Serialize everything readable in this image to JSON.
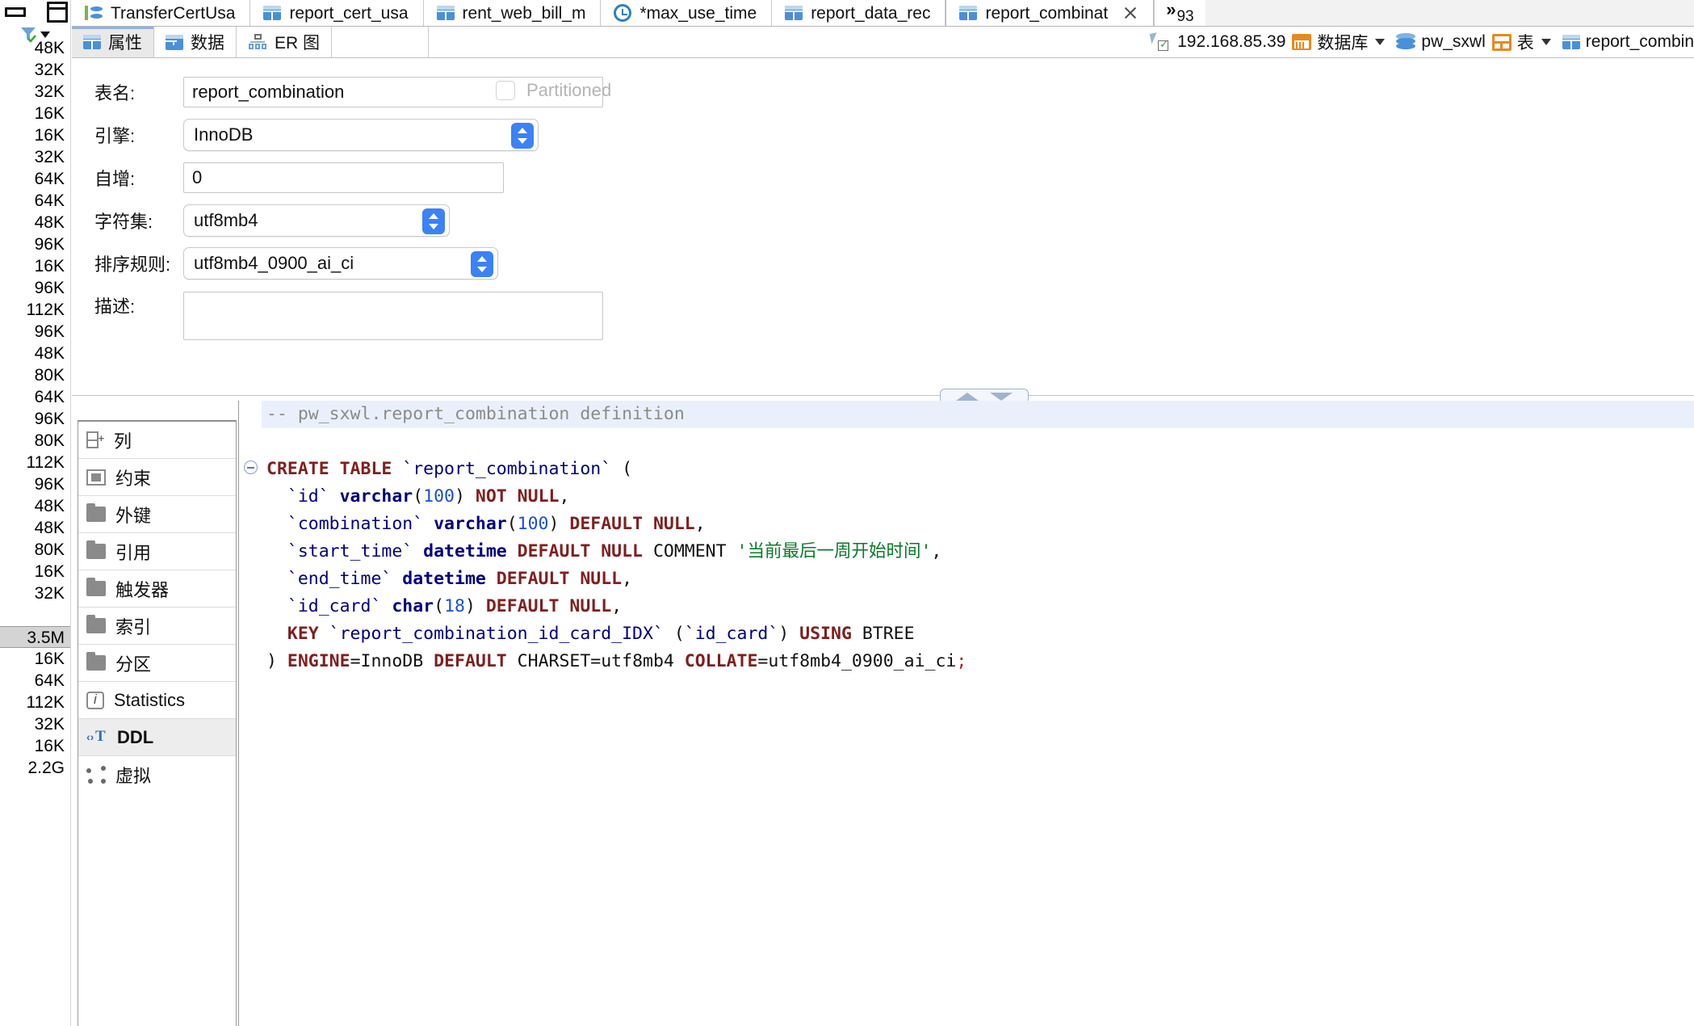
{
  "window": {
    "minimize_icon": "minimize-icon",
    "maximize_icon": "maximize-icon"
  },
  "size_column": {
    "filter_icon": "filter-icon",
    "dropdown_icon": "chevron-down-icon",
    "values": [
      "48K",
      "32K",
      "32K",
      "16K",
      "16K",
      "32K",
      "64K",
      "64K",
      "48K",
      "96K",
      "16K",
      "96K",
      "112K",
      "96K",
      "48K",
      "80K",
      "64K",
      "96K",
      "80K",
      "112K",
      "96K",
      "48K",
      "48K",
      "80K",
      "16K",
      "32K"
    ],
    "selected_value": "3.5M",
    "values_after": [
      "16K",
      "64K",
      "112K",
      "32K",
      "16K",
      "2.2G"
    ]
  },
  "tabs": [
    {
      "label": "TransferCertUsa",
      "icon": "transfer-icon",
      "active": false,
      "closable": false
    },
    {
      "label": "report_cert_usa",
      "icon": "table-icon",
      "active": false,
      "closable": false
    },
    {
      "label": "rent_web_bill_m",
      "icon": "table-icon",
      "active": false,
      "closable": false
    },
    {
      "label": "*max_use_time",
      "icon": "clock-icon",
      "active": false,
      "closable": false
    },
    {
      "label": "report_data_rec",
      "icon": "table-icon",
      "active": false,
      "closable": false
    },
    {
      "label": "report_combinat",
      "icon": "table-icon",
      "active": true,
      "closable": true
    }
  ],
  "tab_overflow": {
    "chevron": "»",
    "count": "93"
  },
  "view_tabs": [
    {
      "label": "属性",
      "icon": "table-icon",
      "active": true
    },
    {
      "label": "数据",
      "icon": "data-icon",
      "active": false
    },
    {
      "label": "ER 图",
      "icon": "er-diagram-icon",
      "active": false
    }
  ],
  "breadcrumb": {
    "connection": "192.168.85.39",
    "database_group": "数据库",
    "schema": "pw_sxwl",
    "table_group": "表",
    "table": "report_combin"
  },
  "properties": {
    "table_name_label": "表名:",
    "table_name_value": "report_combination",
    "engine_label": "引擎:",
    "engine_value": "InnoDB",
    "auto_increment_label": "自增:",
    "auto_increment_value": "0",
    "charset_label": "字符集:",
    "charset_value": "utf8mb4",
    "collation_label": "排序规则:",
    "collation_value": "utf8mb4_0900_ai_ci",
    "description_label": "描述:",
    "description_value": "",
    "partitioned_label": "Partitioned",
    "partitioned_checked": false
  },
  "nav_items": [
    {
      "label": "列",
      "icon": "column-icon",
      "active": false
    },
    {
      "label": "约束",
      "icon": "constraint-icon",
      "active": false
    },
    {
      "label": "外键",
      "icon": "folder-icon",
      "active": false
    },
    {
      "label": "引用",
      "icon": "folder-icon",
      "active": false
    },
    {
      "label": "触发器",
      "icon": "folder-icon",
      "active": false
    },
    {
      "label": "索引",
      "icon": "folder-icon",
      "active": false
    },
    {
      "label": "分区",
      "icon": "folder-icon",
      "active": false
    },
    {
      "label": "Statistics",
      "icon": "info-icon",
      "active": false
    },
    {
      "label": "DDL",
      "icon": "ddl-icon",
      "active": true
    },
    {
      "label": "虚拟",
      "icon": "virtual-icon",
      "active": false
    }
  ],
  "ddl": {
    "comment_line": "-- pw_sxwl.report_combination definition",
    "lines": [
      {
        "tokens": [
          {
            "t": "CREATE TABLE ",
            "c": "k-kw"
          },
          {
            "t": "`report_combination`",
            "c": "k-id"
          },
          {
            "t": " (",
            "c": "k-plain"
          }
        ]
      },
      {
        "tokens": [
          {
            "t": "  `id` ",
            "c": "k-id"
          },
          {
            "t": "varchar",
            "c": "k-type"
          },
          {
            "t": "(",
            "c": "k-plain"
          },
          {
            "t": "100",
            "c": "k-num"
          },
          {
            "t": ") ",
            "c": "k-plain"
          },
          {
            "t": "NOT NULL",
            "c": "k-kw"
          },
          {
            "t": ",",
            "c": "k-plain"
          }
        ]
      },
      {
        "tokens": [
          {
            "t": "  `combination` ",
            "c": "k-id"
          },
          {
            "t": "varchar",
            "c": "k-type"
          },
          {
            "t": "(",
            "c": "k-plain"
          },
          {
            "t": "100",
            "c": "k-num"
          },
          {
            "t": ") ",
            "c": "k-plain"
          },
          {
            "t": "DEFAULT NULL",
            "c": "k-kw"
          },
          {
            "t": ",",
            "c": "k-plain"
          }
        ]
      },
      {
        "tokens": [
          {
            "t": "  `start_time` ",
            "c": "k-id"
          },
          {
            "t": "datetime ",
            "c": "k-type"
          },
          {
            "t": "DEFAULT NULL",
            "c": "k-kw"
          },
          {
            "t": " COMMENT ",
            "c": "k-plain"
          },
          {
            "t": "'当前最后一周开始时间'",
            "c": "k-str"
          },
          {
            "t": ",",
            "c": "k-plain"
          }
        ]
      },
      {
        "tokens": [
          {
            "t": "  `end_time` ",
            "c": "k-id"
          },
          {
            "t": "datetime ",
            "c": "k-type"
          },
          {
            "t": "DEFAULT NULL",
            "c": "k-kw"
          },
          {
            "t": ",",
            "c": "k-plain"
          }
        ]
      },
      {
        "tokens": [
          {
            "t": "  `id_card` ",
            "c": "k-id"
          },
          {
            "t": "char",
            "c": "k-type"
          },
          {
            "t": "(",
            "c": "k-plain"
          },
          {
            "t": "18",
            "c": "k-num"
          },
          {
            "t": ") ",
            "c": "k-plain"
          },
          {
            "t": "DEFAULT NULL",
            "c": "k-kw"
          },
          {
            "t": ",",
            "c": "k-plain"
          }
        ]
      },
      {
        "tokens": [
          {
            "t": "  KEY ",
            "c": "k-kw"
          },
          {
            "t": "`report_combination_id_card_IDX`",
            "c": "k-id"
          },
          {
            "t": " (",
            "c": "k-plain"
          },
          {
            "t": "`id_card`",
            "c": "k-id"
          },
          {
            "t": ") ",
            "c": "k-plain"
          },
          {
            "t": "USING",
            "c": "k-kw"
          },
          {
            "t": " BTREE",
            "c": "k-plain"
          }
        ]
      },
      {
        "tokens": [
          {
            "t": ") ",
            "c": "k-plain"
          },
          {
            "t": "ENGINE",
            "c": "k-kw"
          },
          {
            "t": "=InnoDB ",
            "c": "k-plain"
          },
          {
            "t": "DEFAULT",
            "c": "k-kw"
          },
          {
            "t": " CHARSET=utf8mb4 ",
            "c": "k-plain"
          },
          {
            "t": "COLLATE",
            "c": "k-kw"
          },
          {
            "t": "=utf8mb4_0900_ai_ci",
            "c": "k-plain"
          },
          {
            "t": ";",
            "c": "k-semi"
          }
        ]
      }
    ]
  },
  "splitter": {
    "collapse_up_icon": "triangle-up-icon",
    "collapse_down_icon": "triangle-down-icon"
  }
}
